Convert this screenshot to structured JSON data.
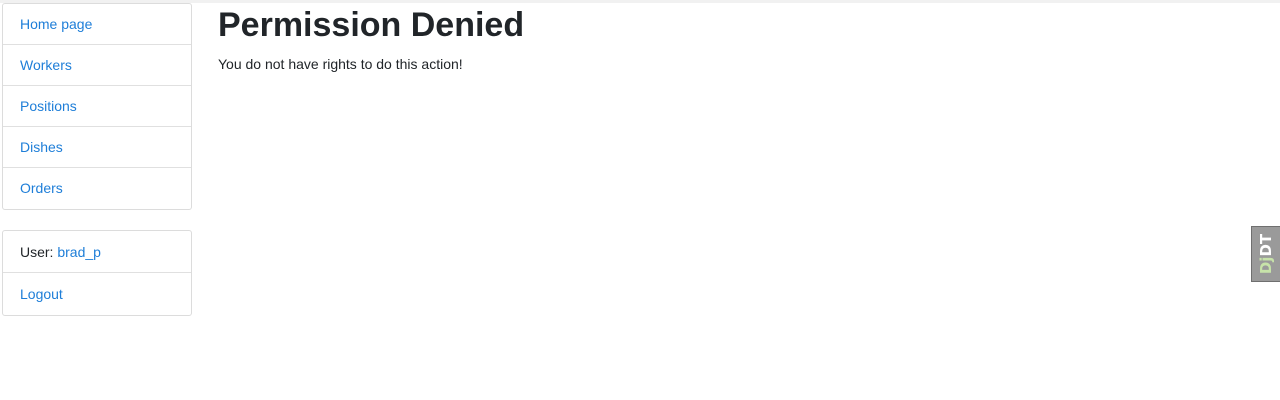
{
  "sidebar": {
    "nav_items": [
      {
        "label": "Home page"
      },
      {
        "label": "Workers"
      },
      {
        "label": "Positions"
      },
      {
        "label": "Dishes"
      },
      {
        "label": "Orders"
      }
    ],
    "user": {
      "prefix": "User: ",
      "username": "brad_p",
      "logout_label": "Logout"
    }
  },
  "main": {
    "title": "Permission Denied",
    "message": "You do not have rights to do this action!"
  },
  "debug_toolbar": {
    "dj": "Dj",
    "dt": "DT"
  },
  "colors": {
    "link": "#1e7ed8",
    "text": "#212529",
    "border": "#dcdcdc"
  }
}
